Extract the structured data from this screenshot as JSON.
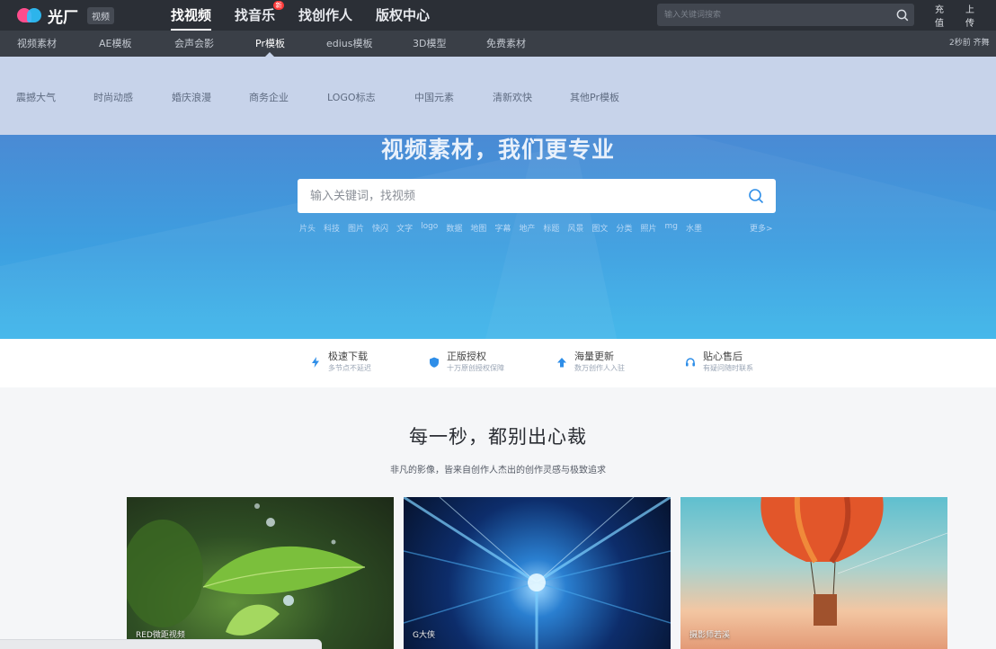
{
  "brand": {
    "name": "光厂",
    "sub": "视频"
  },
  "main_nav": [
    {
      "label": "找视频",
      "active": true
    },
    {
      "label": "找音乐",
      "badge": "新"
    },
    {
      "label": "找创作人"
    },
    {
      "label": "版权中心"
    }
  ],
  "top_search": {
    "placeholder": "输入关键词搜索"
  },
  "top_right": {
    "recharge": "充值",
    "upload": "上传"
  },
  "sub_nav": [
    {
      "label": "视频素材"
    },
    {
      "label": "AE模板"
    },
    {
      "label": "会声会影"
    },
    {
      "label": "Pr模板",
      "active": true
    },
    {
      "label": "edius模板"
    },
    {
      "label": "3D模型"
    },
    {
      "label": "免费素材"
    }
  ],
  "sub_nav_right": "2秒前 齐舞",
  "dropdown_items": [
    "震撼大气",
    "时尚动感",
    "婚庆浪漫",
    "商务企业",
    "LOGO标志",
    "中国元素",
    "清新欢快",
    "其他Pr模板"
  ],
  "hero": {
    "title": "视频素材，我们更专业",
    "search_placeholder": "输入关键词，找视频",
    "hot_tags": [
      "片头",
      "科技",
      "图片",
      "快闪",
      "文字",
      "logo",
      "数据",
      "地图",
      "字幕",
      "地产",
      "标题",
      "风景",
      "图文",
      "分类",
      "照片",
      "mg",
      "水墨"
    ],
    "more": "更多>"
  },
  "features": [
    {
      "title": "极速下载",
      "desc": "多节点不延迟",
      "icon": "lightning-icon",
      "color": "#2e8ee8"
    },
    {
      "title": "正版授权",
      "desc": "十万原创授权保障",
      "icon": "shield-icon",
      "color": "#2e8ee8"
    },
    {
      "title": "海量更新",
      "desc": "数万创作人入驻",
      "icon": "upload-arrow-icon",
      "color": "#2e8ee8"
    },
    {
      "title": "贴心售后",
      "desc": "有疑问随时联系",
      "icon": "headset-icon",
      "color": "#2e8ee8"
    }
  ],
  "showcase": {
    "title": "每一秒，都别出心裁",
    "subtitle": "非凡的影像，皆来自创作人杰出的创作灵感与极致追求",
    "cards": [
      {
        "caption": "RED微距视频",
        "theme": "green-leaf-dewdrop"
      },
      {
        "caption": "G大侠",
        "theme": "blue-light-tunnel"
      },
      {
        "caption": "摄影师若溪",
        "theme": "hot-air-balloon-sunset"
      }
    ]
  }
}
